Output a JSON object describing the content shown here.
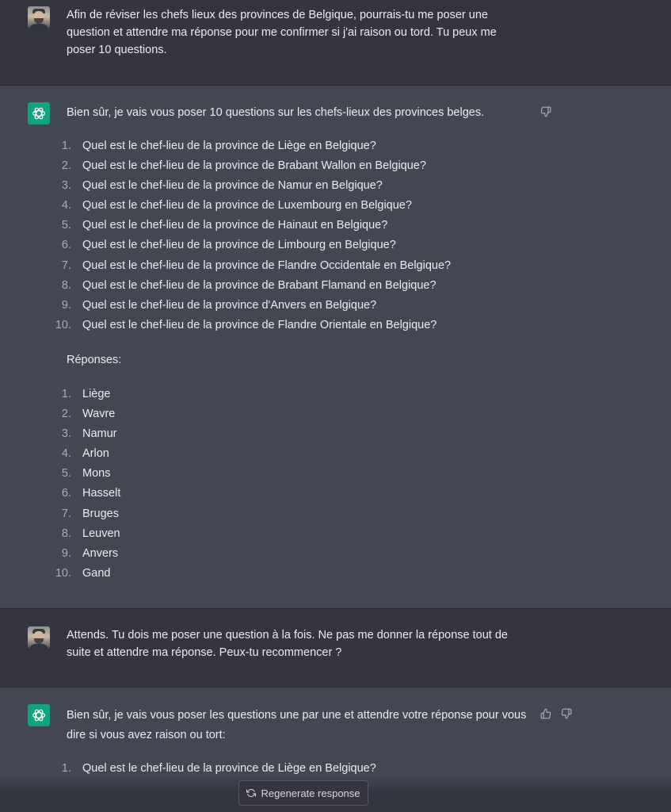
{
  "messages": {
    "user1": {
      "lines": [
        "Afin de réviser les chefs lieux des provinces de Belgique, pourrais-tu me poser une",
        "question et attendre ma réponse pour me confirmer si j'ai raison ou tord. Tu peux me",
        "poser 10 questions."
      ]
    },
    "assistant1": {
      "intro": "Bien sûr, je vais vous poser 10 questions sur les chefs-lieux des provinces belges.",
      "questions": [
        {
          "n": "1.",
          "text": "Quel est le chef-lieu de la province de Liège en Belgique?"
        },
        {
          "n": "2.",
          "text": "Quel est le chef-lieu de la province de Brabant Wallon en Belgique?"
        },
        {
          "n": "3.",
          "text": "Quel est le chef-lieu de la province de Namur en Belgique?"
        },
        {
          "n": "4.",
          "text": "Quel est le chef-lieu de la province de Luxembourg en Belgique?"
        },
        {
          "n": "5.",
          "text": "Quel est le chef-lieu de la province de Hainaut en Belgique?"
        },
        {
          "n": "6.",
          "text": "Quel est le chef-lieu de la province de Limbourg en Belgique?"
        },
        {
          "n": "7.",
          "text": "Quel est le chef-lieu de la province de Flandre Occidentale en Belgique?"
        },
        {
          "n": "8.",
          "text": "Quel est le chef-lieu de la province de Brabant Flamand en Belgique?"
        },
        {
          "n": "9.",
          "text": "Quel est le chef-lieu de la province d'Anvers en Belgique?"
        },
        {
          "n": "10.",
          "text": "Quel est le chef-lieu de la province de Flandre Orientale en Belgique?"
        }
      ],
      "answers_heading": "Réponses:",
      "answers": [
        {
          "n": "1.",
          "text": "Liège"
        },
        {
          "n": "2.",
          "text": "Wavre"
        },
        {
          "n": "3.",
          "text": "Namur"
        },
        {
          "n": "4.",
          "text": "Arlon"
        },
        {
          "n": "5.",
          "text": "Mons"
        },
        {
          "n": "6.",
          "text": "Hasselt"
        },
        {
          "n": "7.",
          "text": "Bruges"
        },
        {
          "n": "8.",
          "text": "Leuven"
        },
        {
          "n": "9.",
          "text": "Anvers"
        },
        {
          "n": "10.",
          "text": "Gand"
        }
      ]
    },
    "user2": {
      "lines": [
        "Attends. Tu dois me poser une question à la fois. Ne pas me donner la réponse tout de",
        "suite et attendre ma réponse. Peux-tu recommencer ?"
      ]
    },
    "assistant2": {
      "lines": [
        "Bien sûr, je vais vous poser les questions une par une et attendre votre réponse pour vous",
        "dire si vous avez raison ou tort:"
      ],
      "questions": [
        {
          "n": "1.",
          "text": "Quel est le chef-lieu de la province de Liège en Belgique?"
        }
      ]
    }
  },
  "regenerate_label": "Regenerate response",
  "colors": {
    "gpt_logo_bg": "#10a37f",
    "assistant_bg": "#444654",
    "user_bg": "#343541"
  }
}
